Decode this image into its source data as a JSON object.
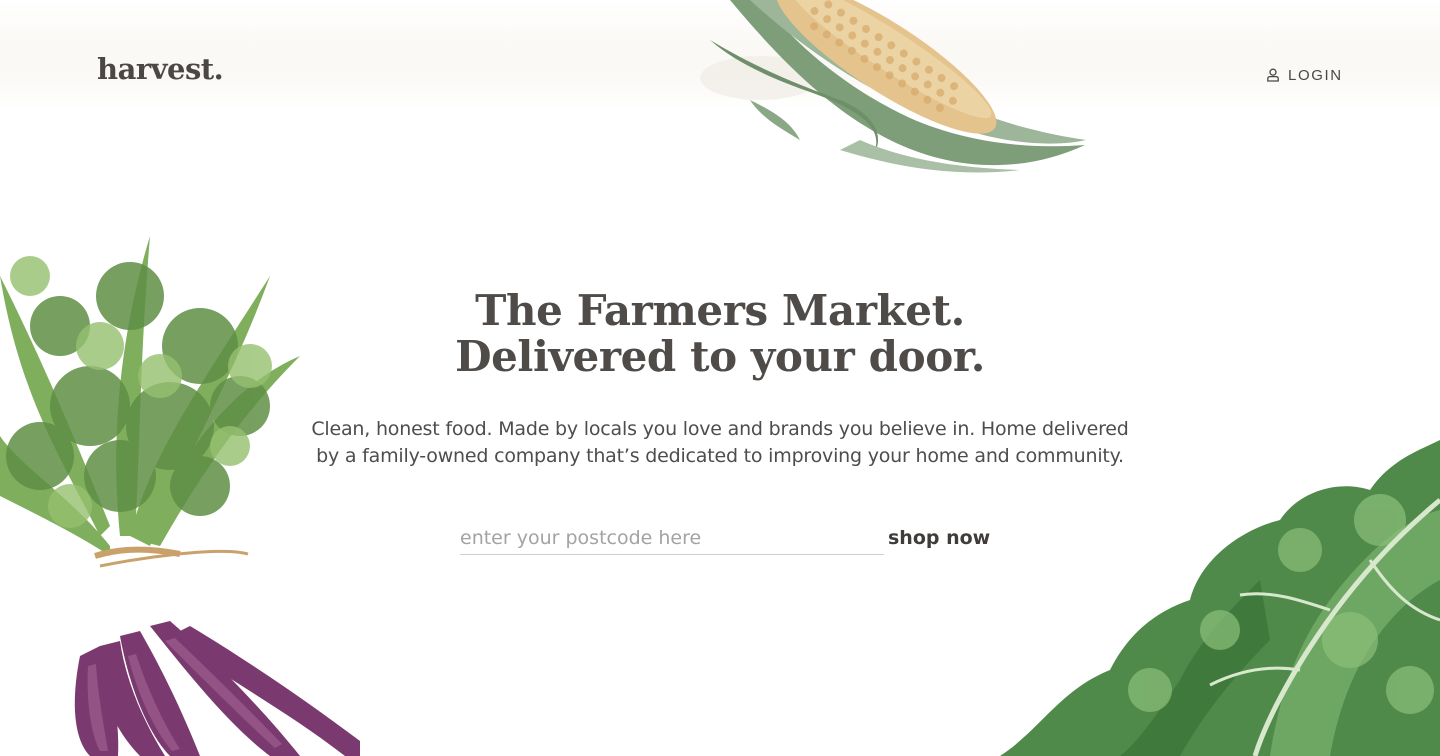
{
  "brand": {
    "logo": "harvest."
  },
  "header": {
    "login_label": "LOGIN",
    "login_icon": "user-icon"
  },
  "hero": {
    "title_line1": "The Farmers Market.",
    "title_line2": "Delivered to your door.",
    "text_line1": "Clean, honest food. Made by locals you love and brands you believe in. Home delivered",
    "text_line2": "by a family-owned company that’s dedicated to improving your home and community."
  },
  "search": {
    "placeholder": "enter your postcode here",
    "value": "",
    "button_label": "shop now"
  },
  "illustrations": [
    "corn-illustration",
    "carrots-illustration",
    "kale-illustration"
  ],
  "colors": {
    "text": "#4b4846",
    "background": "#ffffff",
    "leaf_green": "#4f8a4a",
    "corn_yellow": "#e2b76a",
    "carrot_purple": "#7a3a6f"
  }
}
